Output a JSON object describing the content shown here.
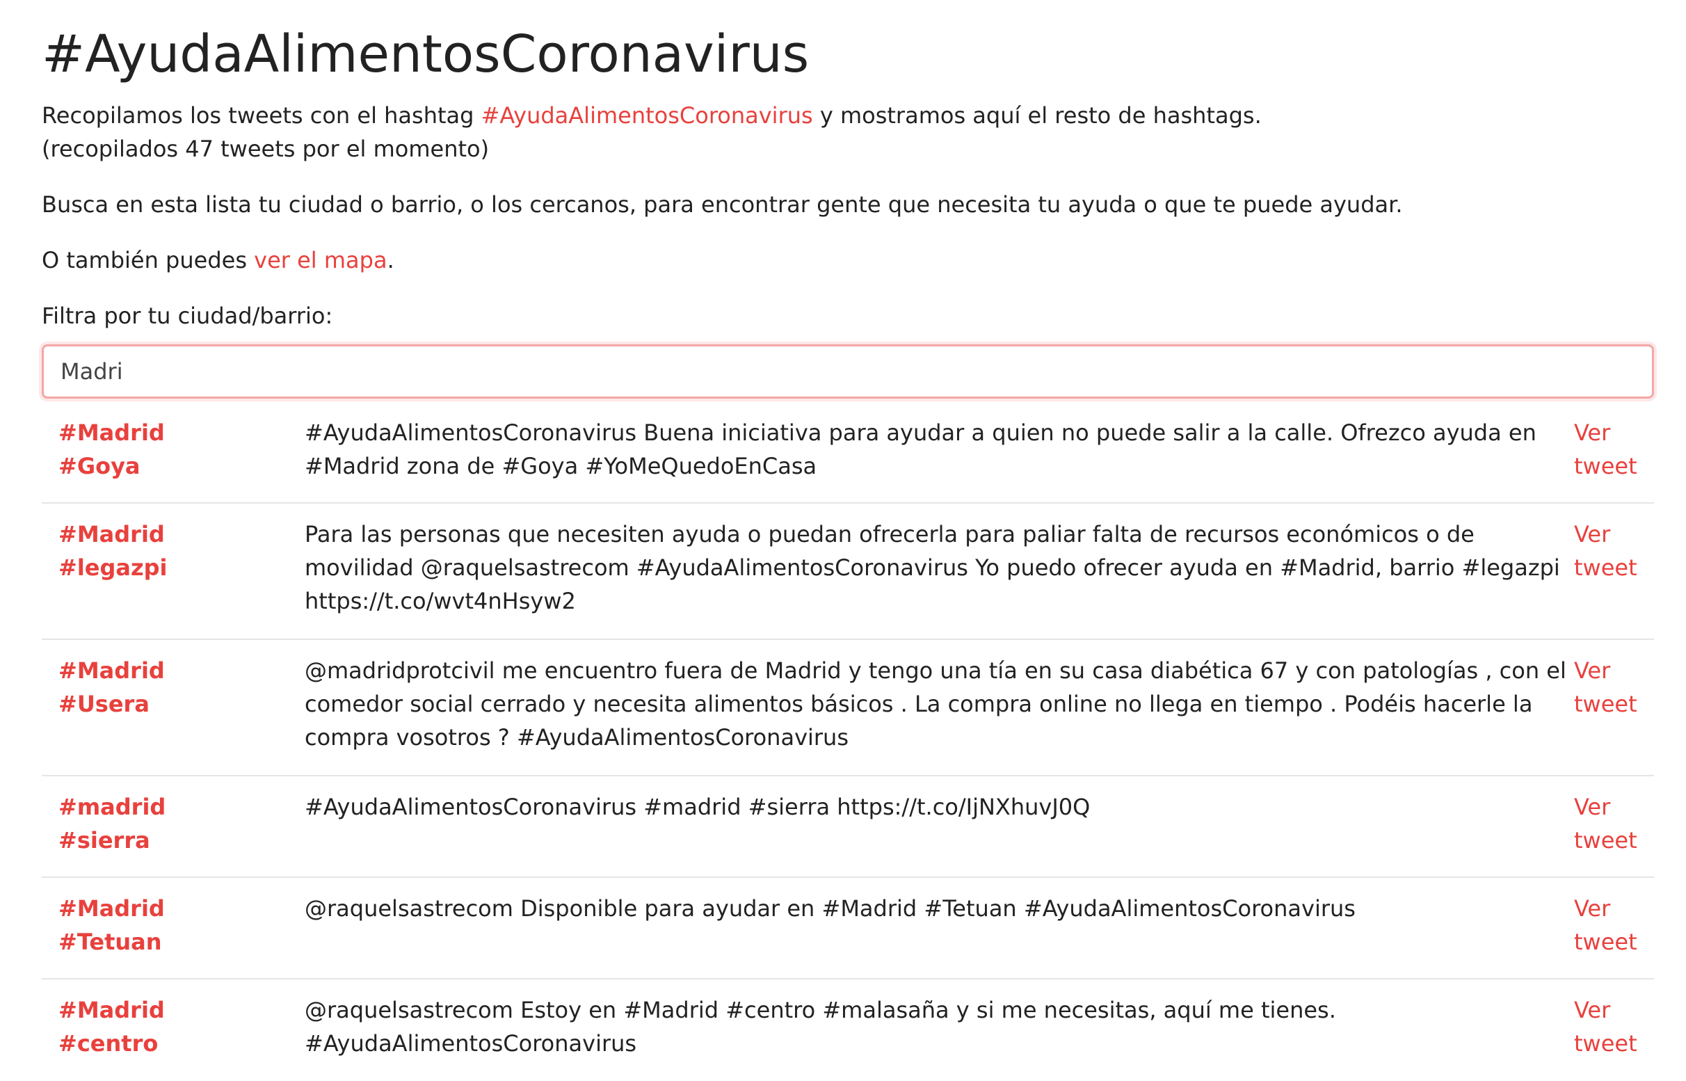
{
  "page": {
    "title": "#AyudaAlimentosCoronavirus",
    "intro_before": "Recopilamos los tweets con el hashtag ",
    "intro_link": "#AyudaAlimentosCoronavirus",
    "intro_after": " y mostramos aquí el resto de hashtags.",
    "count_text": "(recopilados 47 tweets por el momento)",
    "busca_text": "Busca en esta lista tu ciudad o barrio, o los cercanos, para encontrar gente que necesita tu ayuda o que te puede ayudar.",
    "mapa_before": "O también puedes ",
    "mapa_link": "ver el mapa",
    "mapa_after": ".",
    "filter_label": "Filtra por tu ciudad/barrio:"
  },
  "search": {
    "value": "Madri",
    "placeholder": ""
  },
  "colors": {
    "accent": "#e8413d",
    "text": "#222222",
    "divider": "#e5e5e5"
  },
  "rows": [
    {
      "tag1": "#Madrid",
      "tag2": "#Goya",
      "text": "#AyudaAlimentosCoronavirus Buena iniciativa para ayudar a quien no puede salir a la calle. Ofrezco ayuda en #Madrid zona de #Goya #YoMeQuedoEnCasa",
      "ver1": "Ver",
      "ver2": "tweet"
    },
    {
      "tag1": "#Madrid",
      "tag2": "#legazpi",
      "text": "Para las personas que necesiten ayuda o puedan ofrecerla para paliar falta de recursos económicos o de movilidad @raquelsastrecom #AyudaAlimentosCoronavirus Yo puedo ofrecer ayuda en #Madrid, barrio #legazpi https://t.co/wvt4nHsyw2",
      "ver1": "Ver",
      "ver2": "tweet"
    },
    {
      "tag1": "#Madrid",
      "tag2": "#Usera",
      "text": "@madridprotcivil me encuentro fuera de Madrid y tengo una tía en su casa diabética 67 y con patologías , con el comedor social cerrado y necesita alimentos básicos . La compra online no llega en tiempo . Podéis hacerle la compra vosotros ? #AyudaAlimentosCoronavirus",
      "ver1": "Ver",
      "ver2": "tweet"
    },
    {
      "tag1": "#madrid",
      "tag2": "#sierra",
      "text": "#AyudaAlimentosCoronavirus #madrid #sierra https://t.co/IjNXhuvJ0Q",
      "ver1": "Ver",
      "ver2": "tweet"
    },
    {
      "tag1": "#Madrid",
      "tag2": "#Tetuan",
      "text": "@raquelsastrecom Disponible para ayudar en #Madrid #Tetuan #AyudaAlimentosCoronavirus",
      "ver1": "Ver",
      "ver2": "tweet"
    },
    {
      "tag1": "#Madrid",
      "tag2": "#centro",
      "text": "@raquelsastrecom Estoy en #Madrid #centro #malasaña y si me necesitas, aquí me tienes. #AyudaAlimentosCoronavirus",
      "ver1": "Ver",
      "ver2": "tweet"
    }
  ]
}
